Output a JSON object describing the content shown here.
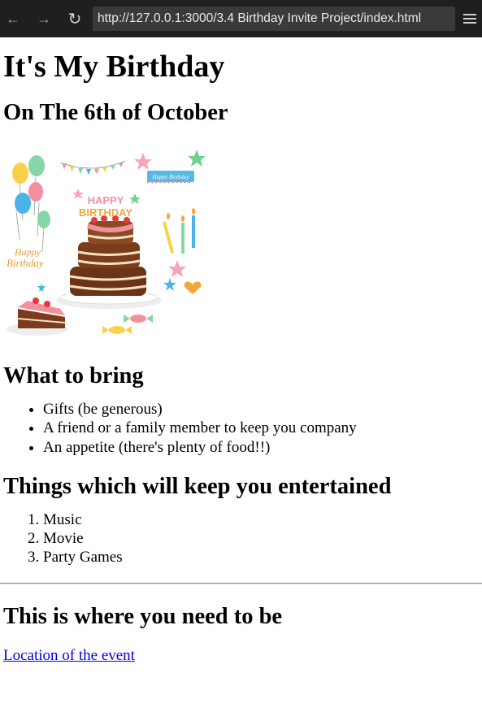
{
  "browser": {
    "url": "http://127.0.0.1:3000/3.4 Birthday Invite Project/index.html",
    "back_icon": "←",
    "forward_icon": "→",
    "reload_icon": "↻"
  },
  "page": {
    "title": "It's My Birthday",
    "date_heading": "On The 6th of October",
    "cake_image": {
      "banner_text": "Happy Birthday",
      "cake_text_1": "HAPPY",
      "cake_text_2": "BIRTHDAY",
      "script_text_1": "Happy",
      "script_text_2": "Birthday"
    },
    "bring_heading": "What to bring",
    "bring_items": [
      "Gifts (be generous)",
      "A friend or a family member to keep you company",
      "An appetite (there's plenty of food!!)"
    ],
    "entertain_heading": "Things which will keep you entertained",
    "entertain_items": [
      "Music",
      "Movie",
      "Party Games"
    ],
    "location_heading": "This is where you need to be",
    "location_link": "Location of the event"
  }
}
